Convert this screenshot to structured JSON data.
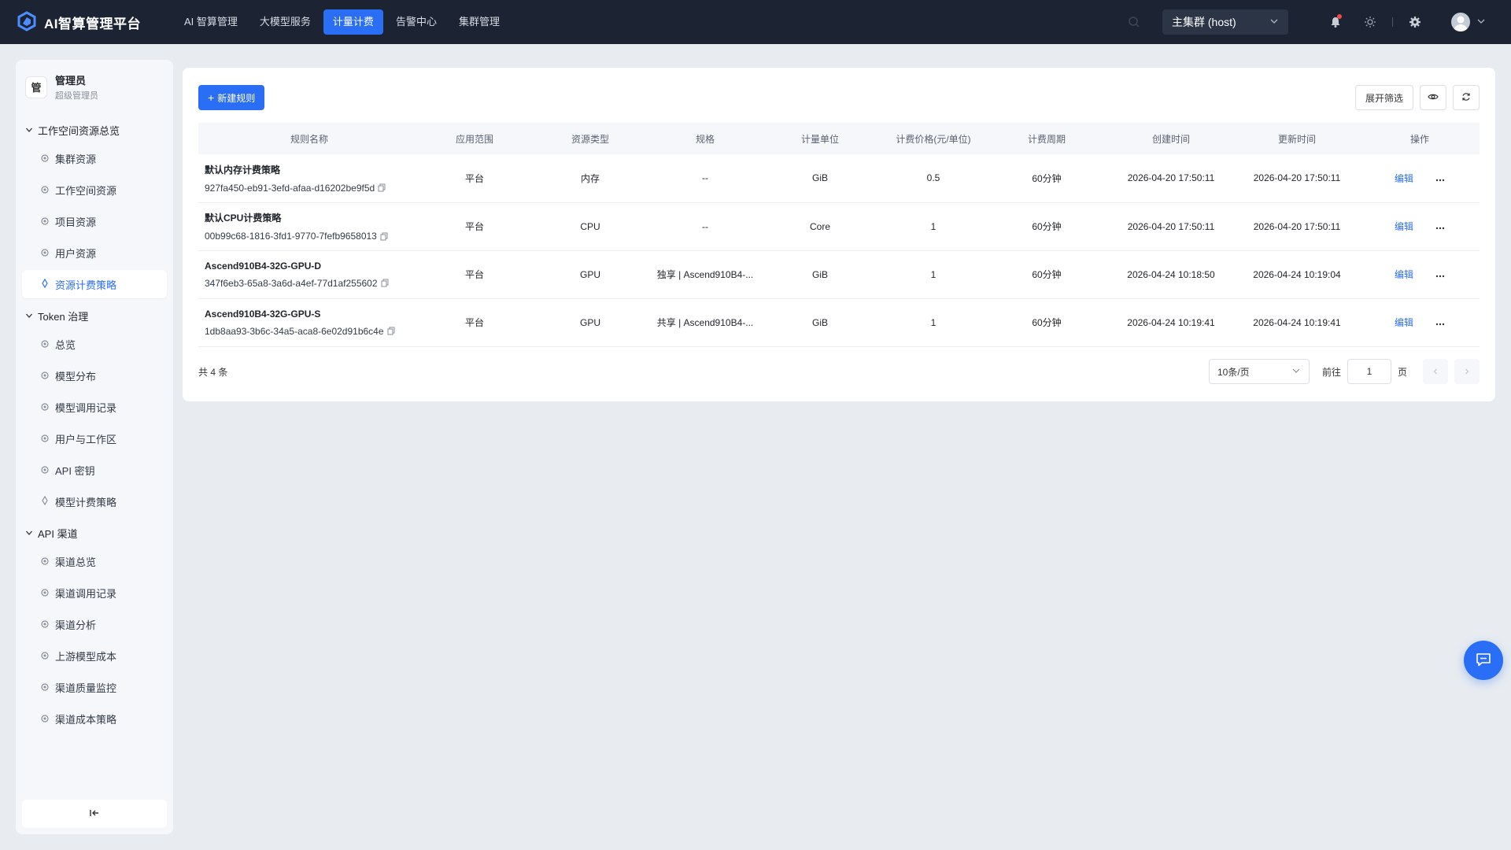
{
  "brand": {
    "title": "AI智算管理平台",
    "logo_icon": "hexagon-logo-icon"
  },
  "nav": [
    {
      "label": "AI 智算管理",
      "active": false
    },
    {
      "label": "大模型服务",
      "active": false
    },
    {
      "label": "计量计费",
      "active": true
    },
    {
      "label": "告警中心",
      "active": false
    },
    {
      "label": "集群管理",
      "active": false
    }
  ],
  "topbar": {
    "cluster_selected": "主集群 (host)"
  },
  "user": {
    "badge": "管",
    "name": "管理员",
    "role": "超级管理员"
  },
  "sidebar": {
    "groups": [
      {
        "title": "工作空间资源总览",
        "items": [
          "集群资源",
          "工作空间资源",
          "项目资源",
          "用户资源",
          "资源计费策略"
        ]
      },
      {
        "title": "Token 治理",
        "items": [
          "总览",
          "模型分布",
          "模型调用记录",
          "用户与工作区",
          "API 密钥",
          "模型计费策略"
        ]
      },
      {
        "title": "API 渠道",
        "items": [
          "渠道总览",
          "渠道调用记录",
          "渠道分析",
          "上游模型成本",
          "渠道质量监控",
          "渠道成本策略"
        ]
      }
    ],
    "active_item": "资源计费策略"
  },
  "toolbar": {
    "new_rule": "新建规则",
    "expand_filter": "展开筛选"
  },
  "table": {
    "headers": [
      "规则名称",
      "应用范围",
      "资源类型",
      "规格",
      "计量单位",
      "计费价格(元/单位)",
      "计费周期",
      "创建时间",
      "更新时间",
      "操作"
    ],
    "rows": [
      {
        "name": "默认内存计费策略",
        "id": "927fa450-eb91-3efd-afaa-d16202be9f5d",
        "scope": "平台",
        "type": "内存",
        "spec": "--",
        "unit": "GiB",
        "price": "0.5",
        "period": "60分钟",
        "created": "2026-04-20 17:50:11",
        "updated": "2026-04-20 17:50:11",
        "action": "编辑"
      },
      {
        "name": "默认CPU计费策略",
        "id": "00b99c68-1816-3fd1-9770-7fefb9658013",
        "scope": "平台",
        "type": "CPU",
        "spec": "--",
        "unit": "Core",
        "price": "1",
        "period": "60分钟",
        "created": "2026-04-20 17:50:11",
        "updated": "2026-04-20 17:50:11",
        "action": "编辑"
      },
      {
        "name": "Ascend910B4-32G-GPU-D",
        "id": "347f6eb3-65a8-3a6d-a4ef-77d1af255602",
        "scope": "平台",
        "type": "GPU",
        "spec": "独享 | Ascend910B4-...",
        "unit": "GiB",
        "price": "1",
        "period": "60分钟",
        "created": "2026-04-24 10:18:50",
        "updated": "2026-04-24 10:19:04",
        "action": "编辑"
      },
      {
        "name": "Ascend910B4-32G-GPU-S",
        "id": "1db8aa93-3b6c-34a5-aca8-6e02d91b6c4e",
        "scope": "平台",
        "type": "GPU",
        "spec": "共享 | Ascend910B4-...",
        "unit": "GiB",
        "price": "1",
        "period": "60分钟",
        "created": "2026-04-24 10:19:41",
        "updated": "2026-04-24 10:19:41",
        "action": "编辑"
      }
    ]
  },
  "pagination": {
    "total": "共 4 条",
    "page_size": "10条/页",
    "goto_label": "前往",
    "page_value": "1",
    "page_suffix": "页"
  },
  "colors": {
    "primary": "#2a6ef5",
    "topbar": "#1c2433",
    "background": "#e8ecf1"
  }
}
